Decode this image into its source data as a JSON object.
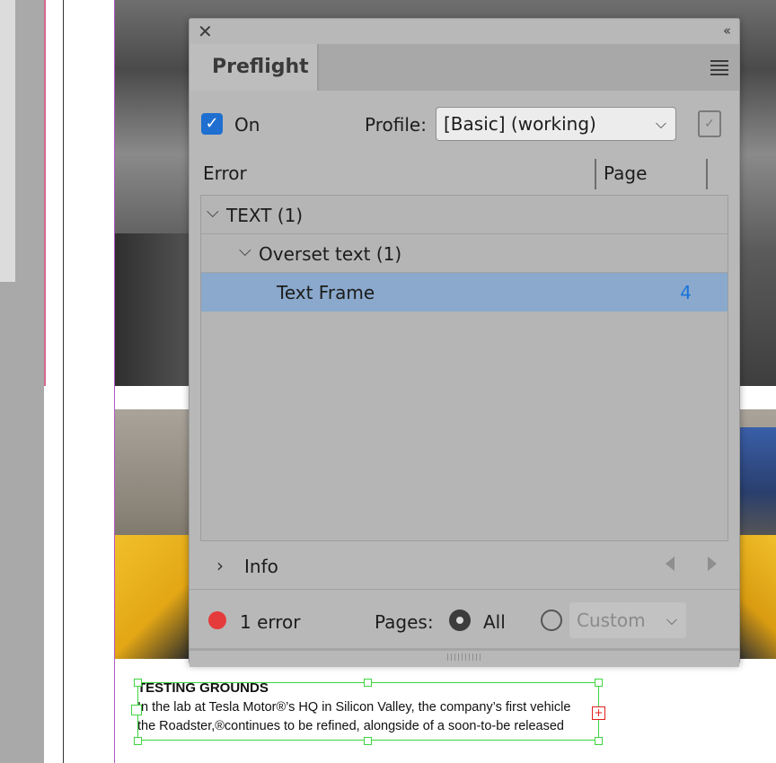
{
  "panel": {
    "title": "Preflight",
    "close_icon": "close-icon",
    "collapse_icon": "double-chevron-icon",
    "menu_icon": "panel-menu-icon"
  },
  "controls": {
    "on_label": "On",
    "on_checked": true,
    "profile_label": "Profile:",
    "profile_value": "[Basic] (working)"
  },
  "columns": {
    "error": "Error",
    "page": "Page"
  },
  "errors": {
    "category": "TEXT (1)",
    "subcategory": "Overset text (1)",
    "item": "Text Frame",
    "item_page": "4"
  },
  "info": {
    "label": "Info"
  },
  "status": {
    "error_count": "1 error",
    "pages_label": "Pages:",
    "all_label": "All",
    "custom_value": "Custom",
    "selected_scope": "All"
  },
  "document": {
    "heading": "TESTING GROUNDS",
    "line1": "In the lab at Tesla Motor®’s HQ in Silicon Valley, the company’s first vehicle",
    "line2": "the Roadster,®continues to be refined, alongside of a soon-to-be released"
  },
  "colors": {
    "accent": "#1e6fd0",
    "selected_row": "#8aa9cc",
    "error": "#e63b3b",
    "frame": "#3fd43f"
  }
}
